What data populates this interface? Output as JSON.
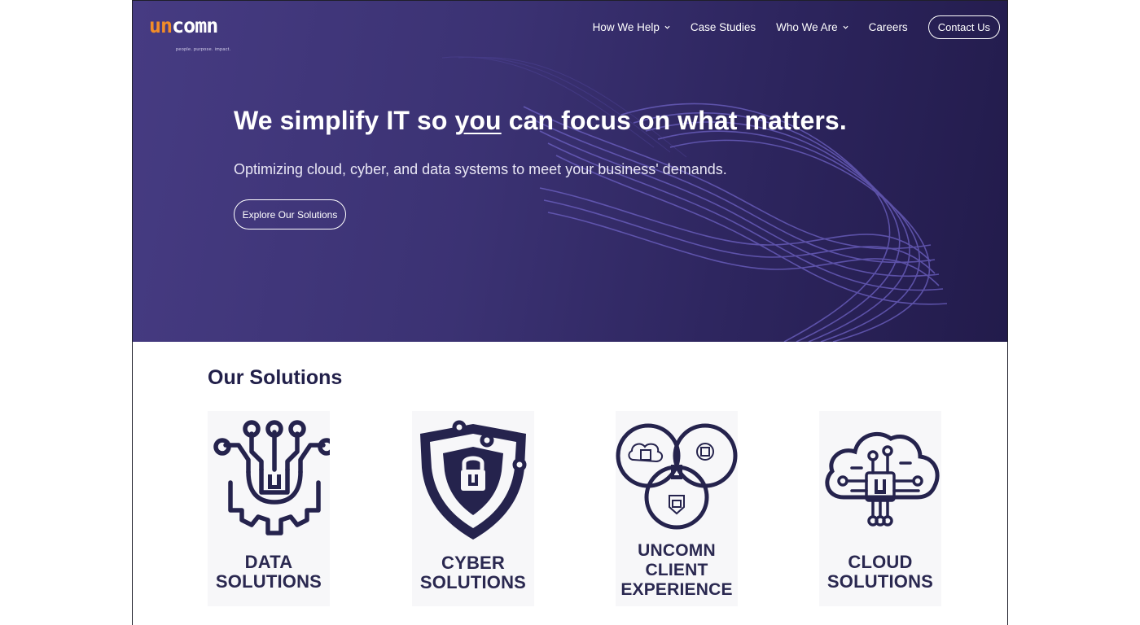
{
  "header": {
    "logo_text_orange": "un",
    "logo_text_white": "comn",
    "logo_tagline": "people. purpose. impact.",
    "nav": [
      {
        "label": "How We Help",
        "has_dropdown": true
      },
      {
        "label": "Case Studies",
        "has_dropdown": false
      },
      {
        "label": "Who We Are",
        "has_dropdown": true
      },
      {
        "label": "Careers",
        "has_dropdown": false
      }
    ],
    "contact_label": "Contact Us"
  },
  "hero": {
    "headline_pre": "We simplify IT so ",
    "headline_emph": "you",
    "headline_post": " can focus on what matters.",
    "subheadline": "Optimizing cloud, cyber, and data systems to meet your business' demands.",
    "cta_label": "Explore Our Solutions"
  },
  "solutions": {
    "title": "Our Solutions",
    "cards": [
      {
        "line1": "DATA",
        "line2": "SOLUTIONS",
        "icon": "data-gear-icon"
      },
      {
        "line1": "CYBER",
        "line2": "SOLUTIONS",
        "icon": "cyber-shield-icon"
      },
      {
        "line1": "UNCOMN",
        "line2": "CLIENT",
        "line3": "EXPERIENCE",
        "icon": "venn-circles-icon"
      },
      {
        "line1": "CLOUD",
        "line2": "SOLUTIONS",
        "icon": "cloud-chip-icon"
      }
    ]
  },
  "colors": {
    "hero_bg": "#3b3273",
    "accent_orange": "#f28c28",
    "heading_navy": "#22204a",
    "icon_navy": "#25234d"
  }
}
